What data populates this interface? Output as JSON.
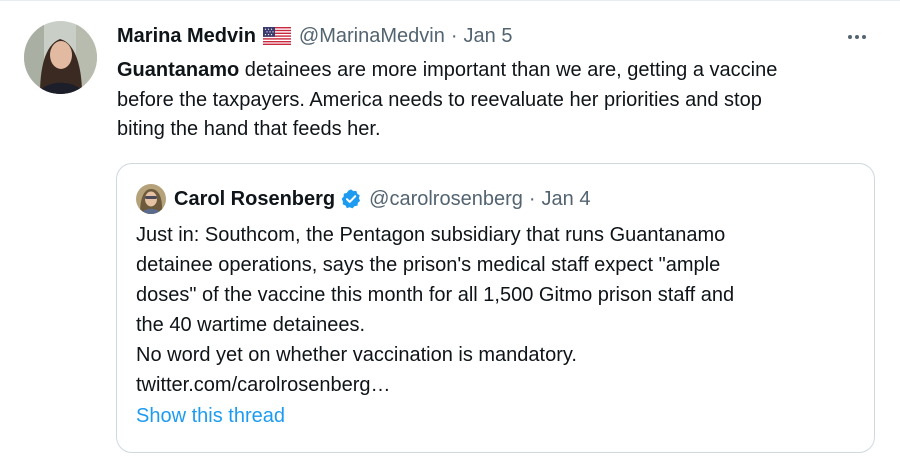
{
  "tweet": {
    "author_name": "Marina Medvin",
    "handle": "@MarinaMedvin",
    "separator": "·",
    "date": "Jan 5",
    "flag_icon": "us-flag-icon",
    "more_icon": "more-horizontal-icon",
    "text_bold": "Guantanamo",
    "text_line1_rest": " detainees are more important than we are, getting a vaccine",
    "text_line2": "before the taxpayers. America needs to reevaluate her priorities and stop",
    "text_line3": "biting the hand that feeds her."
  },
  "quoted_tweet": {
    "author_name": "Carol Rosenberg",
    "verified_icon": "verified-badge-icon",
    "handle": "@carolrosenberg",
    "separator": "·",
    "date": "Jan 4",
    "lines": [
      "Just in: Southcom, the Pentagon subsidiary that runs Guantanamo",
      "detainee operations, says the prison's medical staff expect \"ample",
      "doses\" of the vaccine this month for all 1,500 Gitmo prison staff and",
      "the 40 wartime detainees.",
      "No word yet on whether vaccination is mandatory.",
      "twitter.com/carolrosenberg…"
    ],
    "show_thread": "Show this thread"
  },
  "colors": {
    "text": "#0f1419",
    "secondary": "#536471",
    "link": "#1d9bf0",
    "verified": "#1d9bf0",
    "border": "#cfd9de"
  }
}
